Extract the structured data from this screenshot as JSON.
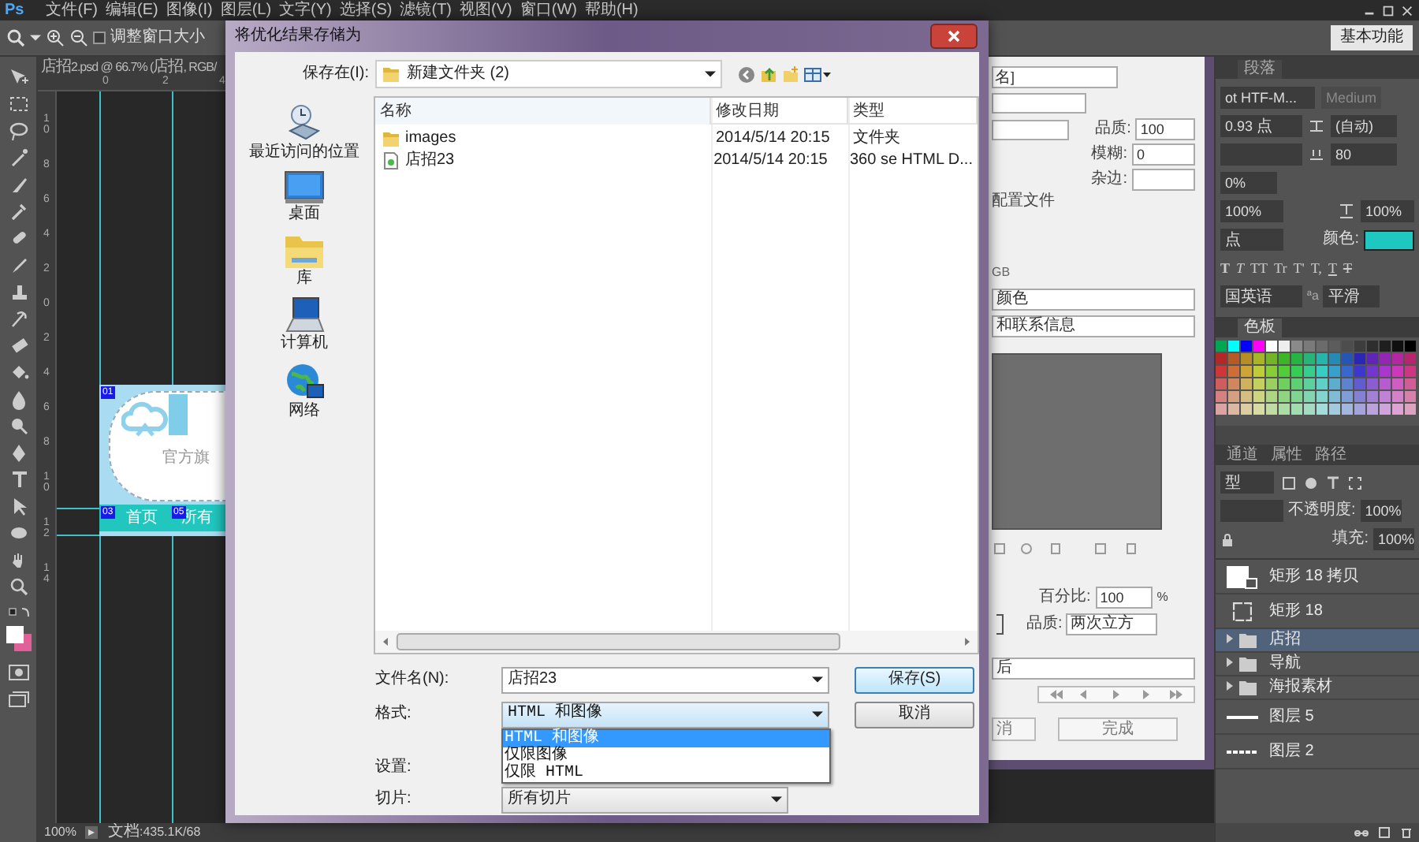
{
  "menu_bar": {
    "logo": "Ps",
    "items": [
      "文件(F)",
      "编辑(E)",
      "图像(I)",
      "图层(L)",
      "文字(Y)",
      "选择(S)",
      "滤镜(T)",
      "视图(V)",
      "窗口(W)",
      "帮助(H)"
    ]
  },
  "options_bar": {
    "resize_windows": {
      "label": "调整窗口大小",
      "checked": false
    },
    "workspace": "基本功能"
  },
  "document": {
    "tab": "店招2.psd @ 66.7% (店招, RGB/",
    "top_ruler": [
      "0",
      "2",
      "4"
    ],
    "left_ruler": [
      "10",
      "8",
      "6",
      "4",
      "2",
      "0",
      "2",
      "4",
      "6",
      "8",
      "10",
      "12",
      "14"
    ],
    "slices": [
      "01",
      "03",
      "05"
    ],
    "tagline": "官方旗",
    "nav": [
      "首页",
      "所有"
    ]
  },
  "status_bar": {
    "zoom": "100%",
    "doc": "文档:435.1K/68"
  },
  "save_dialog": {
    "title": "将优化结果存储为",
    "save_in_label": "保存在(I):",
    "folder": "新建文件夹 (2)",
    "places": [
      {
        "kind": "recent",
        "label": "最近访问的位置"
      },
      {
        "kind": "desktop",
        "label": "桌面"
      },
      {
        "kind": "library",
        "label": "库"
      },
      {
        "kind": "computer",
        "label": "计算机"
      },
      {
        "kind": "network",
        "label": "网络"
      }
    ],
    "columns": [
      "名称",
      "修改日期",
      "类型"
    ],
    "files": [
      {
        "kind": "folder",
        "name": "images",
        "modified": "2014/5/14 20:15",
        "type": "文件夹"
      },
      {
        "kind": "html",
        "name": "店招23",
        "modified": "2014/5/14 20:15",
        "type": "360 se HTML D..."
      }
    ],
    "file_name_label": "文件名(N):",
    "file_name": "店招23",
    "format_label": "格式:",
    "format": "HTML 和图像",
    "format_options": [
      {
        "label": "HTML 和图像",
        "selected": true
      },
      {
        "label": "仅限图像",
        "selected": false
      },
      {
        "label": "仅限 HTML",
        "selected": false
      }
    ],
    "settings_label": "设置:",
    "slices_label": "切片:",
    "slices": "所有切片",
    "save_button": "保存(S)",
    "cancel_button": "取消"
  },
  "web_dialog": {
    "preset": "名]",
    "quality_label": "品质:",
    "quality": "100",
    "blur_label": "模糊:",
    "blur": "0",
    "matte_label": "杂边:",
    "profile": "配置文件",
    "color_mode": "GB",
    "color_option": "颜色",
    "metadata": "和联系信息",
    "percent_label": "百分比:",
    "percent": "100",
    "percent_unit": "%",
    "resample_label": "品质:",
    "resample": "两次立方",
    "animation": "后",
    "cancel": "消",
    "done": "完成"
  },
  "character_panel": {
    "tab": "段落",
    "font": "ot HTF-M...",
    "style": "Medium",
    "size": "0.93 点",
    "leading": "(自动)",
    "tracking": "80",
    "scale": "0%",
    "vscale": "100%",
    "hscale": "100%",
    "baseline": "点",
    "color_label": "颜色:",
    "color": "#1ec8c0",
    "style_buttons": [
      {
        "kind": "bold",
        "text": "T"
      },
      {
        "kind": "italic",
        "text": "T"
      },
      {
        "kind": "caps",
        "text": "TT"
      },
      {
        "kind": "smallcaps",
        "text": "Tr"
      },
      {
        "kind": "super",
        "text": "T'"
      },
      {
        "kind": "sub",
        "text": "T,"
      },
      {
        "kind": "underline",
        "text": "T"
      },
      {
        "kind": "strike",
        "text": "T"
      }
    ],
    "language": "国英语",
    "aa_label": "ªa",
    "aa": "平滑"
  },
  "swatches_panel": {
    "tab": "色板"
  },
  "layers_panel": {
    "tabs": [
      "通道",
      "属性",
      "路径"
    ],
    "filter": "型",
    "opacity_label": "不透明度:",
    "opacity": "100%",
    "fill_label": "填充:",
    "fill": "100%",
    "layers": [
      {
        "kind": "shape",
        "name": "矩形 18 拷贝",
        "selected": false
      },
      {
        "kind": "outline",
        "name": "矩形 18",
        "selected": false
      },
      {
        "kind": "group",
        "name": "店招",
        "selected": true
      },
      {
        "kind": "group",
        "name": "导航",
        "selected": false
      },
      {
        "kind": "group",
        "name": "海报素材",
        "selected": false
      },
      {
        "kind": "line",
        "name": "图层 5",
        "selected": false
      },
      {
        "kind": "dashed",
        "name": "图层 2",
        "selected": false
      }
    ]
  }
}
